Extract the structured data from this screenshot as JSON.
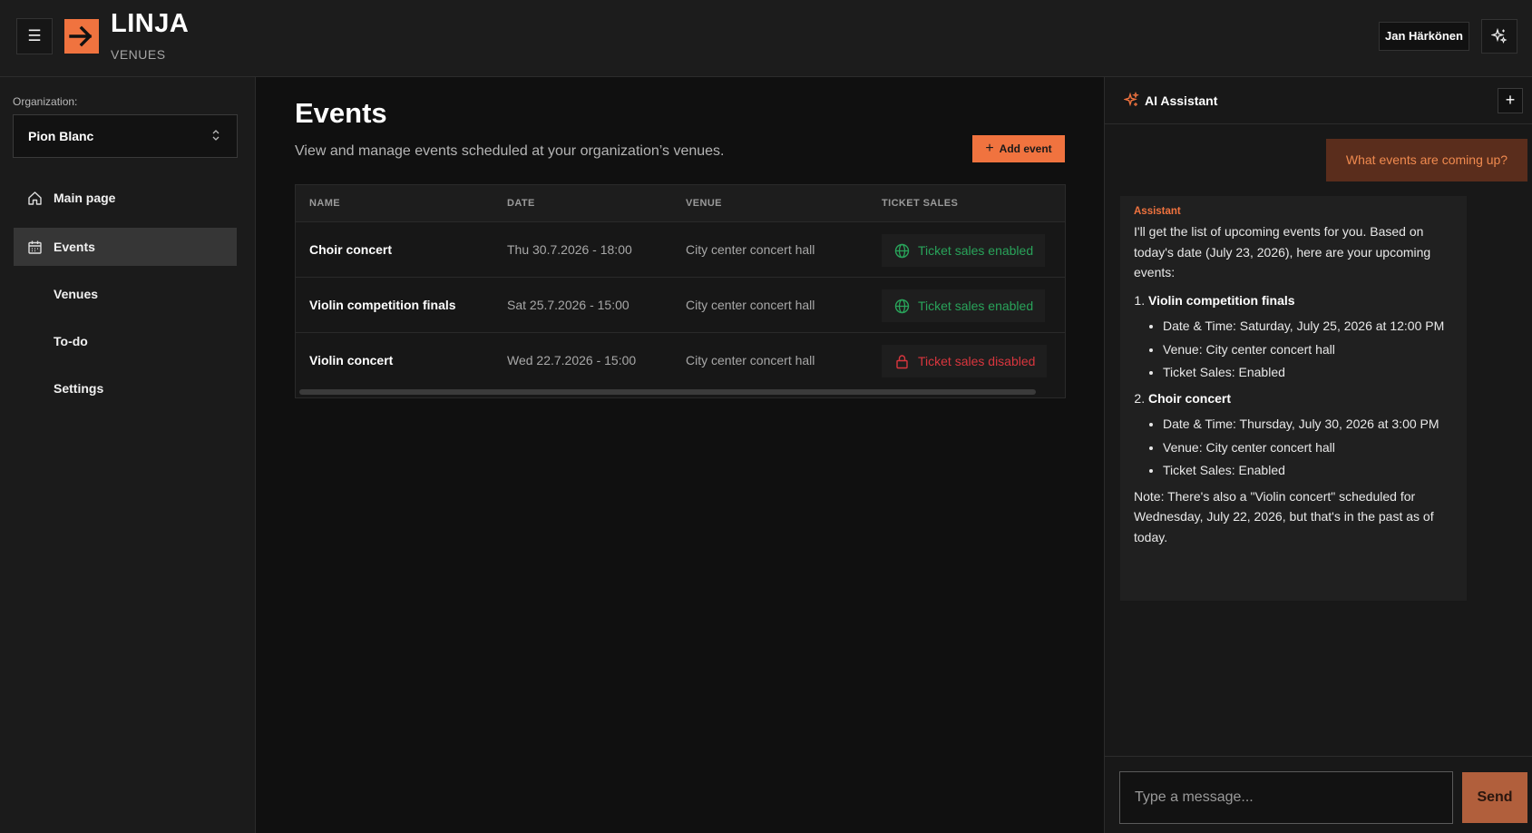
{
  "header": {
    "brand_title": "LINJA",
    "brand_subtitle": "VENUES",
    "user_name": "Jan Härkönen",
    "accent_color": "#f0733f"
  },
  "sidebar": {
    "org_label": "Organization:",
    "org_value": "Pion Blanc",
    "items": [
      {
        "label": "Main page",
        "icon": "home-icon",
        "active": false
      },
      {
        "label": "Events",
        "icon": "calendar-icon",
        "active": true
      },
      {
        "label": "Venues",
        "icon": "",
        "active": false
      },
      {
        "label": "To-do",
        "icon": "",
        "active": false
      },
      {
        "label": "Settings",
        "icon": "",
        "active": false
      }
    ]
  },
  "main": {
    "title": "Events",
    "description": "View and manage events scheduled at your organization’s venues.",
    "add_button_label": "Add event",
    "table": {
      "columns": [
        "NAME",
        "DATE",
        "VENUE",
        "TICKET SALES"
      ],
      "rows": [
        {
          "name": "Choir concert",
          "date": "Thu 30.7.2026 - 18:00",
          "venue": "City center concert hall",
          "ticket_sales": "Ticket sales enabled",
          "status": "enabled"
        },
        {
          "name": "Violin competition finals",
          "date": "Sat 25.7.2026 - 15:00",
          "venue": "City center concert hall",
          "ticket_sales": "Ticket sales enabled",
          "status": "enabled"
        },
        {
          "name": "Violin concert",
          "date": "Wed 22.7.2026 - 15:00",
          "venue": "City center concert hall",
          "ticket_sales": "Ticket sales disabled",
          "status": "disabled"
        }
      ]
    }
  },
  "assistant": {
    "title": "AI Assistant",
    "user_message": "What events are coming up?",
    "reply": {
      "sender": "Assistant",
      "intro": "I'll get the list of upcoming events for you. Based on today's date (July 23, 2026), here are your upcoming events:",
      "events": [
        {
          "name": "Violin competition finals",
          "details": [
            "Date & Time: Saturday, July 25, 2026 at 12:00 PM",
            "Venue: City center concert hall",
            "Ticket Sales: Enabled"
          ]
        },
        {
          "name": "Choir concert",
          "details": [
            "Date & Time: Thursday, July 30, 2026 at 3:00 PM",
            "Venue: City center concert hall",
            "Ticket Sales: Enabled"
          ]
        }
      ],
      "note": "Note: There's also a \"Violin concert\" scheduled for Wednesday, July 22, 2026, but that's in the past as of today."
    },
    "input_placeholder": "Type a message...",
    "send_label": "Send"
  }
}
